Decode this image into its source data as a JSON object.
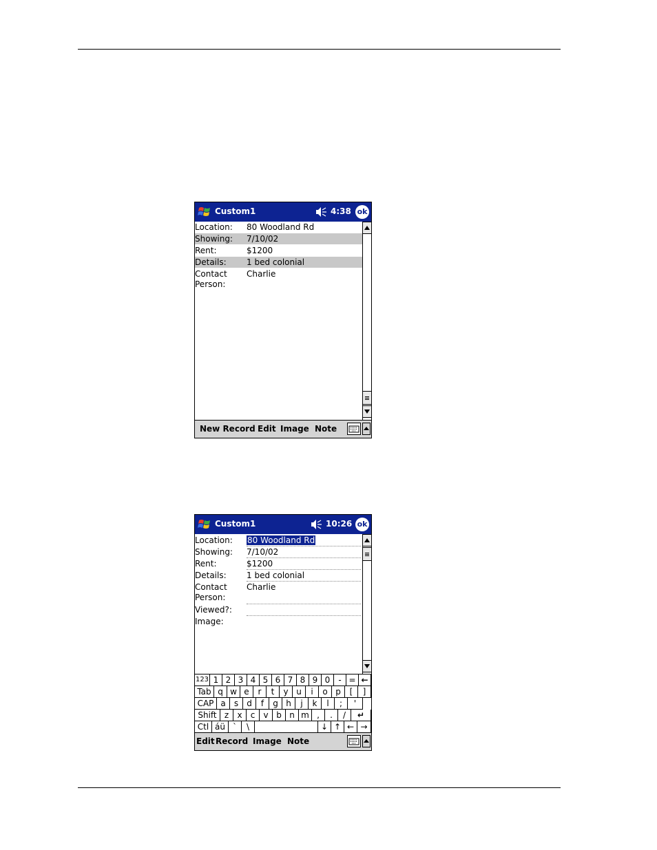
{
  "screen1": {
    "title": "Custom1",
    "time": "4:38",
    "ok_label": "ok",
    "fields": [
      {
        "label": "Location:",
        "value": "80 Woodland Rd"
      },
      {
        "label": "Showing:",
        "value": "7/10/02"
      },
      {
        "label": "Rent:",
        "value": "$1200"
      },
      {
        "label": "Details:",
        "value": "1 bed colonial"
      },
      {
        "label": "Contact",
        "value": "Charlie"
      },
      {
        "label": "Person:",
        "value": ""
      }
    ],
    "menu": [
      "New Record",
      "Edit",
      "Image",
      "Note"
    ]
  },
  "screen2": {
    "title": "Custom1",
    "time": "10:26",
    "ok_label": "ok",
    "fields": [
      {
        "label": "Location:",
        "value": "80 Woodland Rd"
      },
      {
        "label": "Showing:",
        "value": "7/10/02"
      },
      {
        "label": "Rent:",
        "value": "$1200"
      },
      {
        "label": "Details:",
        "value": "1 bed colonial"
      },
      {
        "label": "Contact",
        "value": "Charlie"
      },
      {
        "label": "Person:",
        "value": ""
      },
      {
        "label": "Viewed?:",
        "value": ""
      },
      {
        "label": "Image:",
        "value": ""
      }
    ],
    "keyboard": {
      "row1": [
        "123",
        "1",
        "2",
        "3",
        "4",
        "5",
        "6",
        "7",
        "8",
        "9",
        "0",
        "-",
        "=",
        "←"
      ],
      "row2": [
        "Tab",
        "q",
        "w",
        "e",
        "r",
        "t",
        "y",
        "u",
        "i",
        "o",
        "p",
        "[",
        "]"
      ],
      "row3": [
        "CAP",
        "a",
        "s",
        "d",
        "f",
        "g",
        "h",
        "j",
        "k",
        "l",
        ";",
        "'"
      ],
      "row4": [
        "Shift",
        "z",
        "x",
        "c",
        "v",
        "b",
        "n",
        "m",
        ",",
        ".",
        "/",
        "↵"
      ],
      "row5": [
        "Ctl",
        "áü",
        "`",
        "\\",
        "",
        "↓",
        "↑",
        "←",
        "→"
      ]
    },
    "menu": [
      "Edit",
      "Record",
      "Image",
      "Note"
    ]
  },
  "colors": {
    "titlebar": "#0d2392",
    "highlight": "#c8c8c8",
    "menubar": "#d4d4d4"
  },
  "icons": [
    "windows-start-icon",
    "speaker-icon",
    "keyboard-icon",
    "scroll-up-icon",
    "scroll-down-icon"
  ]
}
